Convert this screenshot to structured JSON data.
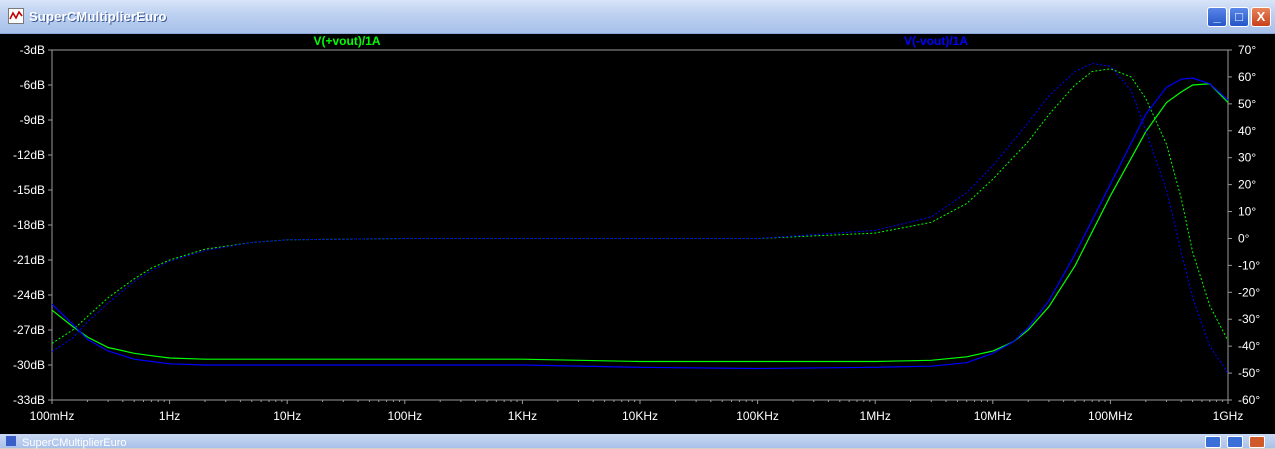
{
  "window": {
    "title": "SuperCMultiplierEuro",
    "minimize_label": "_",
    "maximize_label": "□",
    "close_label": "X",
    "second_window_title": "SuperCMultiplierEuro"
  },
  "chart_data": {
    "type": "line",
    "title": "",
    "x_scale": "log",
    "xlim": [
      0.1,
      1000000000
    ],
    "x_ticks": [
      0.1,
      1,
      10,
      100,
      1000,
      10000,
      100000,
      1000000,
      10000000,
      100000000,
      1000000000
    ],
    "x_tick_labels": [
      "100mHz",
      "1Hz",
      "10Hz",
      "100Hz",
      "1KHz",
      "10KHz",
      "100KHz",
      "1MHz",
      "10MHz",
      "100MHz",
      "1GHz"
    ],
    "ylim_left": [
      -33,
      -3
    ],
    "y_ticks_left": [
      -3,
      -6,
      -9,
      -12,
      -15,
      -18,
      -21,
      -24,
      -27,
      -30,
      -33
    ],
    "y_tick_labels_left": [
      "-3dB",
      "-6dB",
      "-9dB",
      "-12dB",
      "-15dB",
      "-18dB",
      "-21dB",
      "-24dB",
      "-27dB",
      "-30dB",
      "-33dB"
    ],
    "ylim_right": [
      -60,
      70
    ],
    "y_ticks_right": [
      70,
      60,
      50,
      40,
      30,
      20,
      10,
      0,
      -10,
      -20,
      -30,
      -40,
      -50,
      -60
    ],
    "y_tick_labels_right": [
      "70°",
      "60°",
      "50°",
      "40°",
      "30°",
      "20°",
      "10°",
      "0°",
      "-10°",
      "-20°",
      "-30°",
      "-40°",
      "-50°",
      "-60°"
    ],
    "grid": false,
    "series": [
      {
        "name": "V(+vout)/1A",
        "color": "#00ff00",
        "magnitude_db": {
          "x": [
            0.1,
            0.15,
            0.2,
            0.3,
            0.5,
            0.7,
            1,
            2,
            5,
            10,
            100,
            1000,
            10000,
            100000,
            1000000,
            3000000,
            6000000,
            10000000,
            15000000,
            20000000,
            30000000,
            50000000,
            100000000,
            200000000,
            300000000,
            400000000,
            500000000,
            700000000,
            1000000000
          ],
          "y": [
            -25.3,
            -26.7,
            -27.6,
            -28.5,
            -29.0,
            -29.2,
            -29.4,
            -29.5,
            -29.5,
            -29.5,
            -29.5,
            -29.5,
            -29.7,
            -29.7,
            -29.7,
            -29.6,
            -29.3,
            -28.8,
            -28.0,
            -27.0,
            -25.0,
            -21.5,
            -15.5,
            -10.0,
            -7.5,
            -6.6,
            -6.0,
            -5.9,
            -7.5
          ]
        },
        "phase_deg": {
          "x": [
            0.1,
            0.15,
            0.2,
            0.3,
            0.5,
            0.7,
            1,
            2,
            5,
            10,
            100,
            1000,
            10000,
            100000,
            1000000,
            3000000,
            6000000,
            10000000,
            20000000,
            30000000,
            50000000,
            70000000,
            100000000,
            150000000,
            200000000,
            300000000,
            400000000,
            500000000,
            700000000,
            1000000000
          ],
          "y": [
            -39,
            -34,
            -29,
            -22,
            -15,
            -11,
            -8,
            -4,
            -1.5,
            -0.5,
            0,
            0,
            0,
            0,
            2,
            6,
            13,
            22,
            36,
            46,
            57,
            62,
            63,
            60,
            52,
            35,
            15,
            -5,
            -25,
            -38
          ]
        }
      },
      {
        "name": "V(-vout)/1A",
        "color": "#0000ff",
        "magnitude_db": {
          "x": [
            0.1,
            0.15,
            0.2,
            0.3,
            0.5,
            0.7,
            1,
            2,
            5,
            10,
            100,
            1000,
            10000,
            100000,
            1000000,
            3000000,
            6000000,
            10000000,
            15000000,
            20000000,
            30000000,
            50000000,
            100000000,
            200000000,
            300000000,
            400000000,
            500000000,
            700000000,
            1000000000
          ],
          "y": [
            -24.8,
            -26.5,
            -27.8,
            -28.8,
            -29.5,
            -29.7,
            -29.9,
            -30.0,
            -30.0,
            -30.0,
            -30.0,
            -30.0,
            -30.2,
            -30.3,
            -30.2,
            -30.1,
            -29.8,
            -29.0,
            -28.0,
            -26.8,
            -24.5,
            -20.5,
            -14.5,
            -8.5,
            -6.2,
            -5.5,
            -5.4,
            -5.9,
            -7.3
          ]
        },
        "phase_deg": {
          "x": [
            0.1,
            0.15,
            0.2,
            0.3,
            0.5,
            0.7,
            1,
            2,
            5,
            10,
            100,
            1000,
            10000,
            100000,
            1000000,
            3000000,
            6000000,
            10000000,
            20000000,
            30000000,
            50000000,
            70000000,
            100000000,
            150000000,
            200000000,
            300000000,
            400000000,
            500000000,
            700000000,
            1000000000
          ],
          "y": [
            -42,
            -37,
            -31,
            -24,
            -16,
            -12,
            -8.5,
            -4.5,
            -1.5,
            -0.5,
            0,
            0,
            0,
            0,
            3,
            8,
            17,
            27,
            43,
            53,
            62,
            65,
            64,
            55,
            40,
            18,
            -5,
            -22,
            -40,
            -50
          ]
        }
      }
    ]
  }
}
